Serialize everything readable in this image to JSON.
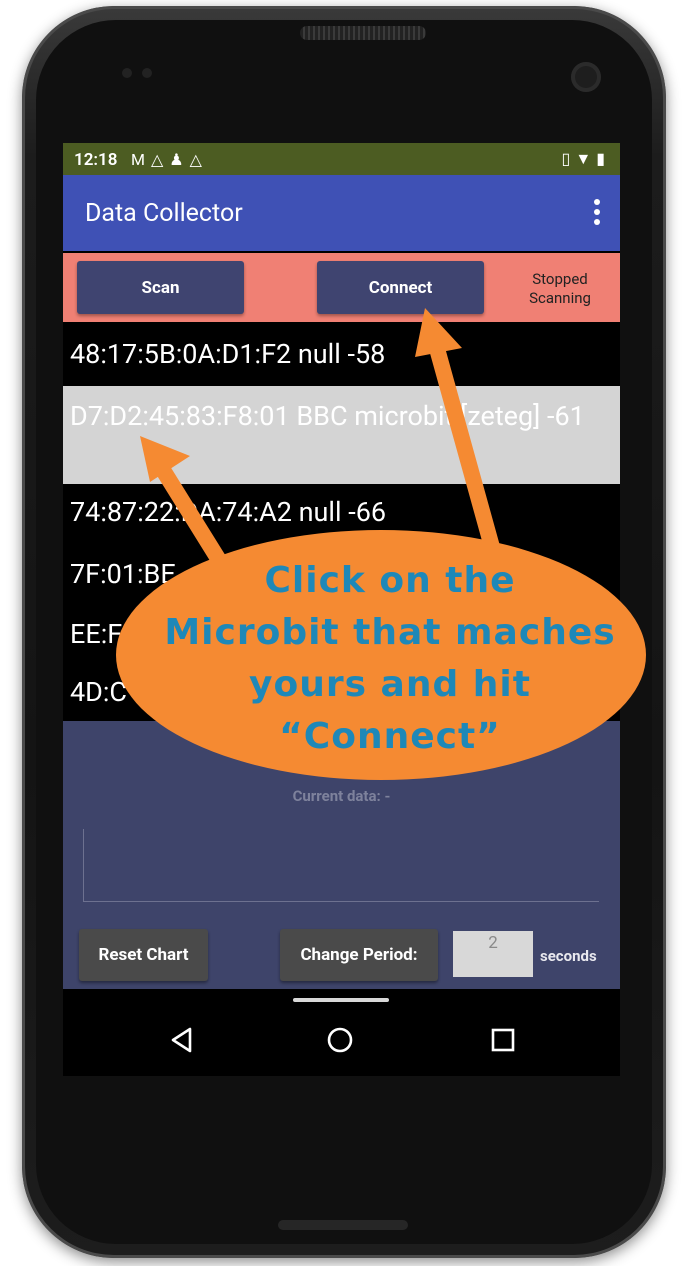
{
  "status_bar": {
    "time": "12:18",
    "left_icons": [
      "gmail-icon",
      "drive-icon",
      "keyhole-icon",
      "drive-icon"
    ],
    "right_icons": [
      "vibrate-icon",
      "wifi-icon",
      "battery-icon"
    ]
  },
  "app_bar": {
    "title": "Data Collector"
  },
  "toolbar": {
    "scan_label": "Scan",
    "connect_label": "Connect",
    "scan_status_line1": "Stopped",
    "scan_status_line2": "Scanning"
  },
  "devices": [
    {
      "text": "48:17:5B:0A:D1:F2 null -58"
    },
    {
      "text": "D7:D2:45:83:F8:01 BBC microbit [zeteg] -61"
    },
    {
      "text": "74:87:22:DA:74:A2 null -66"
    },
    {
      "text": "7F:01:BE"
    },
    {
      "text": "EE:F"
    },
    {
      "text": "4D:C"
    }
  ],
  "lower": {
    "current_data_label": "Current data:  -",
    "reset_label": "Reset Chart",
    "period_label": "Change Period:",
    "period_value": "2",
    "seconds_label": "seconds"
  },
  "callout": {
    "line1": "Click on the",
    "line2": "Microbit that maches",
    "line3": "yours and hit",
    "line4": "“Connect”"
  },
  "colors": {
    "status_bar": "#4c5c22",
    "app_bar": "#3f51b5",
    "toolbar": "#f08074",
    "button": "#3f4470",
    "selected_row": "#d4d4d4",
    "lower_panel": "#3e446a",
    "callout_fill": "#f58a32",
    "callout_text": "#1e88b8"
  }
}
